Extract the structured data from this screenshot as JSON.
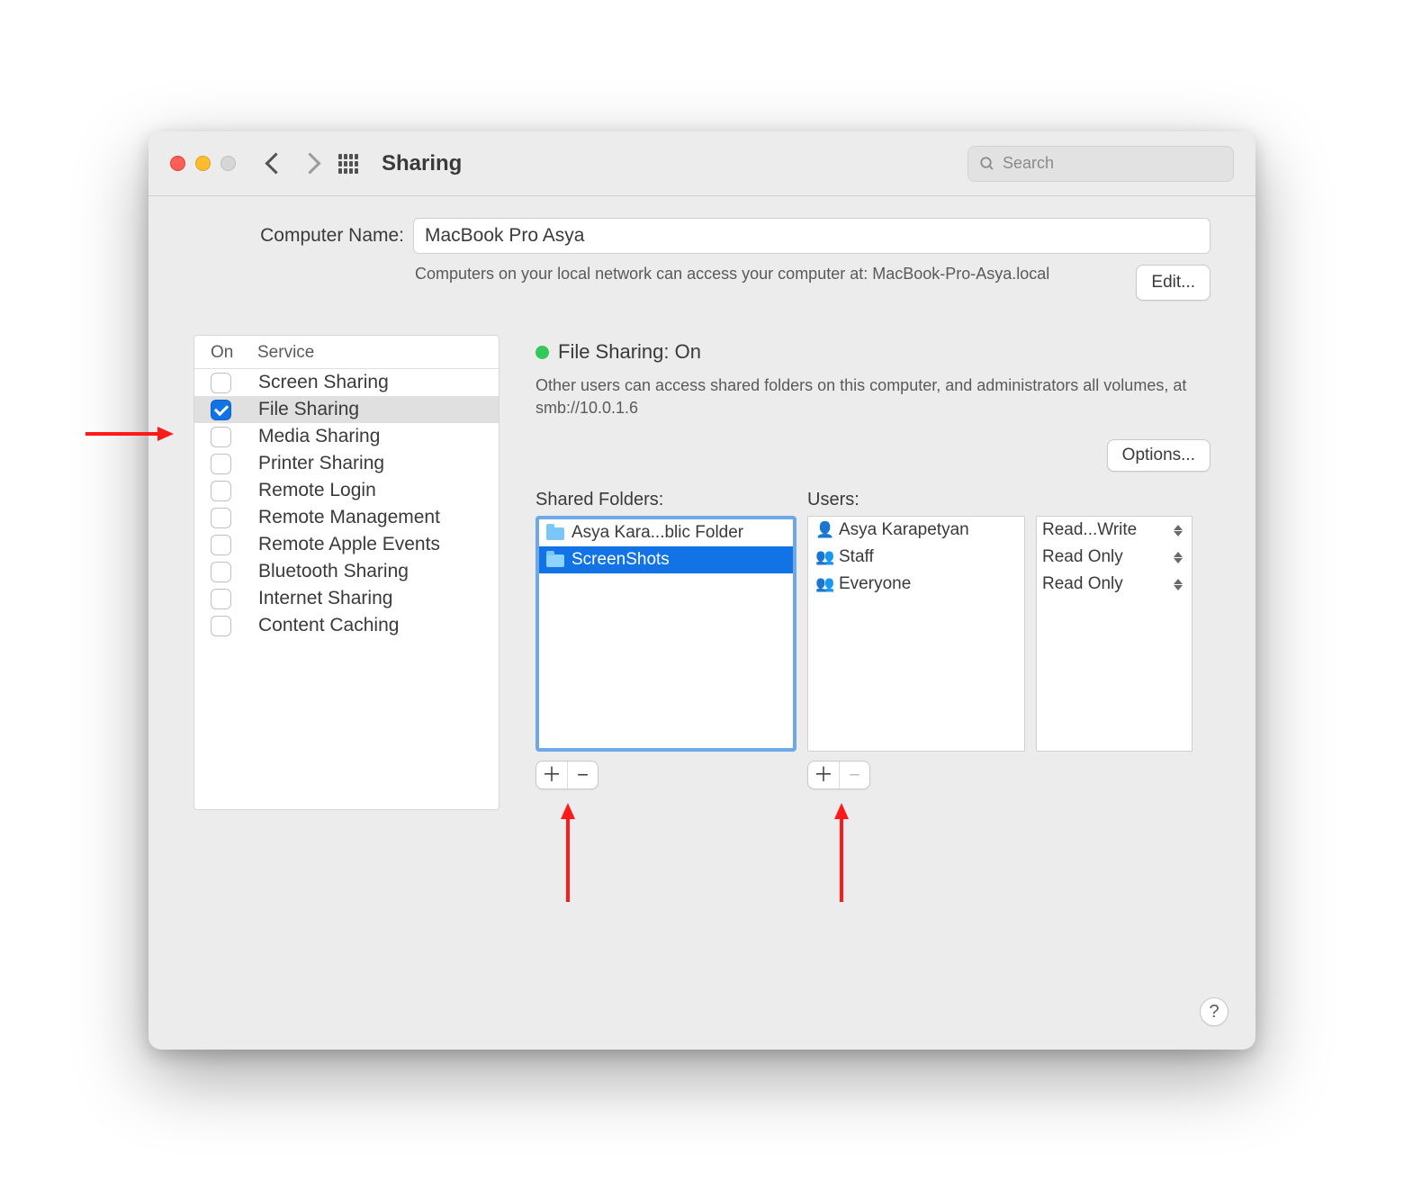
{
  "title": "Sharing",
  "search_placeholder": "Search",
  "computer_name_label": "Computer Name:",
  "computer_name": "MacBook Pro Asya",
  "subtext": "Computers on your local network can access your computer at: MacBook-Pro-Asya.local",
  "edit_label": "Edit...",
  "sidebar": {
    "heads": {
      "on": "On",
      "service": "Service"
    },
    "items": [
      {
        "label": "Screen Sharing",
        "checked": false,
        "selected": false
      },
      {
        "label": "File Sharing",
        "checked": true,
        "selected": true
      },
      {
        "label": "Media Sharing",
        "checked": false,
        "selected": false
      },
      {
        "label": "Printer Sharing",
        "checked": false,
        "selected": false
      },
      {
        "label": "Remote Login",
        "checked": false,
        "selected": false
      },
      {
        "label": "Remote Management",
        "checked": false,
        "selected": false
      },
      {
        "label": "Remote Apple Events",
        "checked": false,
        "selected": false
      },
      {
        "label": "Bluetooth Sharing",
        "checked": false,
        "selected": false
      },
      {
        "label": "Internet Sharing",
        "checked": false,
        "selected": false
      },
      {
        "label": "Content Caching",
        "checked": false,
        "selected": false
      }
    ]
  },
  "status_label": "File Sharing: On",
  "status_desc": "Other users can access shared folders on this computer, and administrators all volumes, at smb://10.0.1.6",
  "options_label": "Options...",
  "shared_folders_label": "Shared Folders:",
  "users_label": "Users:",
  "folders": [
    {
      "name": "Asya Kara...blic Folder",
      "selected": false
    },
    {
      "name": "ScreenShots",
      "selected": true
    }
  ],
  "users": [
    {
      "name": "Asya Karapetyan",
      "icon": "person"
    },
    {
      "name": "Staff",
      "icon": "group"
    },
    {
      "name": "Everyone",
      "icon": "group"
    }
  ],
  "perms": [
    "Read...Write",
    "Read Only",
    "Read Only"
  ],
  "help_label": "?"
}
